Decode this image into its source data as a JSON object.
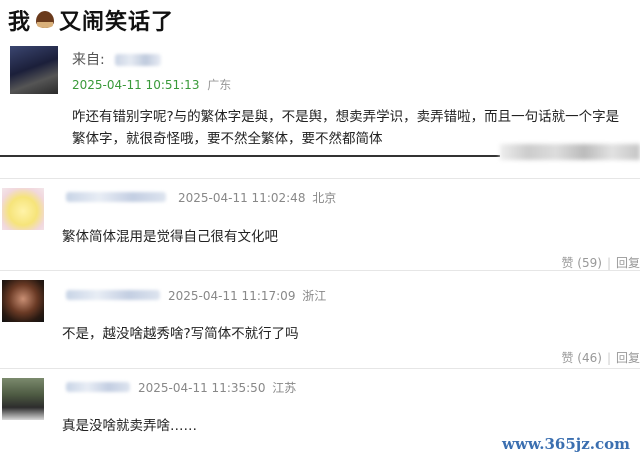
{
  "page": {
    "title_part1": "我",
    "title_part2": "又闹笑话了"
  },
  "post": {
    "from_label": "来自:",
    "time": "2025-04-11 10:51:13",
    "location": "广东",
    "text": "咋还有错别字呢?与的繁体字是與，不是舆，想卖弄学识，卖弄错啦，而且一句话就一个字是繁体字，就很奇怪哦，要不然全繁体，要不然都简体"
  },
  "comments": [
    {
      "time": "2025-04-11 11:02:48",
      "location": "北京",
      "text": "繁体简体混用是觉得自己很有文化吧",
      "like_label": "赞 (59)",
      "reply_label": "回复"
    },
    {
      "time": "2025-04-11 11:17:09",
      "location": "浙江",
      "text": "不是，越没啥越秀啥?写简体不就行了吗",
      "like_label": "赞 (46)",
      "reply_label": "回复"
    },
    {
      "time": "2025-04-11 11:35:50",
      "location": "江苏",
      "text": "真是没啥就卖弄啥……"
    }
  ],
  "watermark": "www.365jz.com",
  "colors": {
    "time_green": "#3a9a3a",
    "meta_gray": "#888888",
    "watermark_blue": "#3b6fb0"
  },
  "icons": {
    "title_emoji": "chestnut-icon"
  }
}
